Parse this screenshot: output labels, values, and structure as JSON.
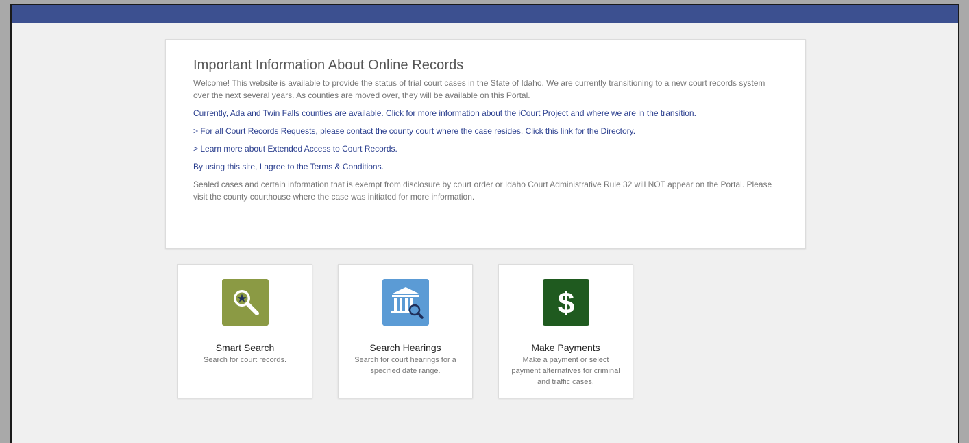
{
  "info": {
    "title": "Important Information About Online Records",
    "welcome": "Welcome! This website is available to provide the status of trial court cases in the State of Idaho. We are currently transitioning to a new court records system over the next several years. As counties are moved over, they will be available on this Portal.",
    "counties_link": "Currently, Ada and Twin Falls counties are available. Click for more information about the iCourt Project and where we are in the transition.",
    "directory_link": "> For all Court Records Requests, please contact the county court where the case resides. Click this link for the Directory.",
    "extended_access_link": "> Learn more about Extended Access to Court Records.",
    "terms_link": "By using this site, I agree to the Terms & Conditions.",
    "sealed_notice": "Sealed cases and certain information that is exempt from disclosure by court order or Idaho Court Administrative Rule 32 will NOT appear on the Portal. Please visit the county courthouse where the case was initiated for more information."
  },
  "tiles": [
    {
      "title": "Smart Search",
      "description": "Search for court records.",
      "icon": "magnifier-star-icon",
      "color": "#8b9a44"
    },
    {
      "title": "Search Hearings",
      "description": "Search for court hearings for a specified date range.",
      "icon": "courthouse-search-icon",
      "color": "#5b9bd5"
    },
    {
      "title": "Make Payments",
      "description": "Make a payment or select payment alternatives for criminal and traffic cases.",
      "icon": "dollar-icon",
      "color": "#1f5a1f"
    }
  ],
  "colors": {
    "topbar": "#3c5090",
    "link": "#2b3f8f"
  }
}
